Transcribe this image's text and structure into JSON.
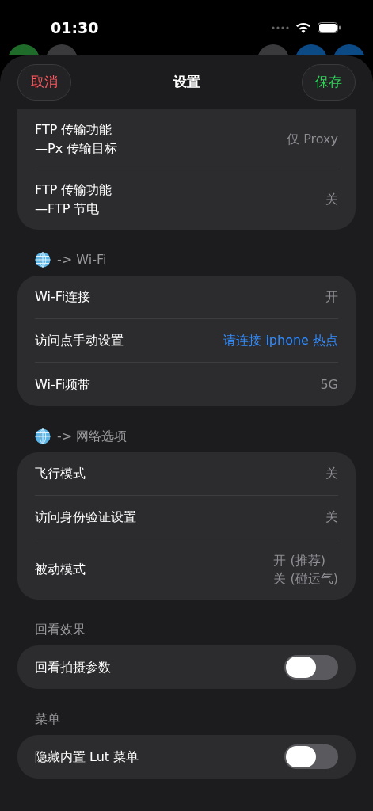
{
  "status_bar": {
    "time": "01:30"
  },
  "header": {
    "cancel": "取消",
    "title": "设置",
    "save": "保存"
  },
  "sections": [
    {
      "rows": [
        {
          "kind": "value",
          "label": "FTP 传输功能\n—Px 传输目标",
          "value": "仅 Proxy"
        },
        {
          "kind": "value",
          "label": "FTP 传输功能\n—FTP 节电",
          "value": "关"
        }
      ]
    },
    {
      "title": "-> Wi-Fi",
      "globe": true,
      "rows": [
        {
          "kind": "value",
          "label": "Wi-Fi连接",
          "value": "开"
        },
        {
          "kind": "link",
          "label": "访问点手动设置",
          "value": "请连接 iphone 热点"
        },
        {
          "kind": "value",
          "label": "Wi-Fi频带",
          "value": "5G"
        }
      ]
    },
    {
      "title": "-> 网络选项",
      "globe": true,
      "rows": [
        {
          "kind": "value",
          "label": "飞行模式",
          "value": "关"
        },
        {
          "kind": "value",
          "label": "访问身份验证设置",
          "value": "关"
        },
        {
          "kind": "value",
          "label": "被动模式",
          "value": "开 (推荐)\n关 (碰运气)"
        }
      ]
    },
    {
      "title": "回看效果",
      "globe": false,
      "rows": [
        {
          "kind": "toggle",
          "label": "回看拍摄参数",
          "on": false
        }
      ]
    },
    {
      "title": "菜单",
      "globe": false,
      "rows": [
        {
          "kind": "toggle",
          "label": "隐藏内置 Lut 菜单",
          "on": false
        }
      ]
    }
  ]
}
